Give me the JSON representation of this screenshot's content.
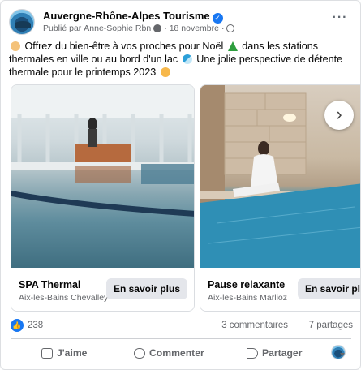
{
  "header": {
    "page_name": "Auvergne-Rhône-Alpes Tourisme",
    "meta_prefix": "Publié par",
    "author": "Anne-Sophie Rbn",
    "separator": "·",
    "date": "18 novembre",
    "more_label": "···"
  },
  "post": {
    "text_1": "Offrez du bien-être à vos proches pour Noël",
    "text_2": "dans les stations thermales en ville ou au bord d'un lac",
    "text_3": "Une  jolie perspective de détente thermale pour le printemps 2023"
  },
  "carousel": {
    "cards": [
      {
        "title": "SPA Thermal",
        "subtitle": "Aix-les-Bains Chevalley",
        "cta": "En savoir plus"
      },
      {
        "title": "Pause relaxante",
        "subtitle": "Aix-les-Bains Marlioz",
        "cta": "En savoir plus"
      }
    ],
    "next_label": "›"
  },
  "reactions": {
    "count": "238",
    "comments": "3 commentaires",
    "shares": "7 partages"
  },
  "actions": {
    "like": "J'aime",
    "comment": "Commenter",
    "share": "Partager"
  },
  "colors": {
    "accent": "#1877f2",
    "secondary_text": "#65676b",
    "button_bg": "#e4e6eb"
  },
  "icons": {
    "verified": "verified-badge-icon",
    "visibility": "globe-icon",
    "like_reaction": "like-reaction-icon",
    "like_action": "thumbs-up-icon",
    "comment_action": "comment-icon",
    "share_action": "share-icon",
    "next": "chevron-right-icon"
  }
}
